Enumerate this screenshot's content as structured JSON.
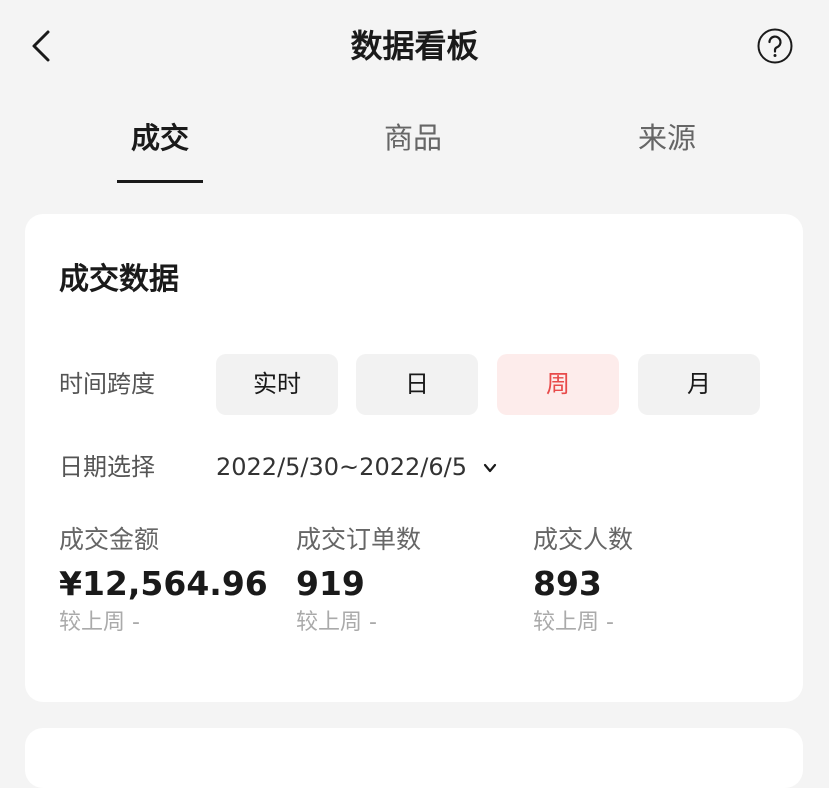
{
  "header": {
    "title": "数据看板"
  },
  "tabs": [
    {
      "label": "成交"
    },
    {
      "label": "商品"
    },
    {
      "label": "来源"
    }
  ],
  "card": {
    "title": "成交数据",
    "time_span": {
      "label": "时间跨度",
      "options": [
        "实时",
        "日",
        "周",
        "月"
      ],
      "selected": "周"
    },
    "date": {
      "label": "日期选择",
      "value": "2022/5/30~2022/6/5"
    },
    "metrics": [
      {
        "label": "成交金额",
        "value": "¥12,564.96",
        "compare": "较上周 -"
      },
      {
        "label": "成交订单数",
        "value": "919",
        "compare": "较上周 -"
      },
      {
        "label": "成交人数",
        "value": "893",
        "compare": "较上周 -"
      }
    ]
  },
  "colors": {
    "accent": "#e84a4a",
    "accent_bg": "#fdeceb",
    "page_bg": "#f4f4f4"
  },
  "icons": {
    "back": "chevron-left-icon",
    "help": "question-circle-icon",
    "dropdown": "chevron-down-icon"
  }
}
